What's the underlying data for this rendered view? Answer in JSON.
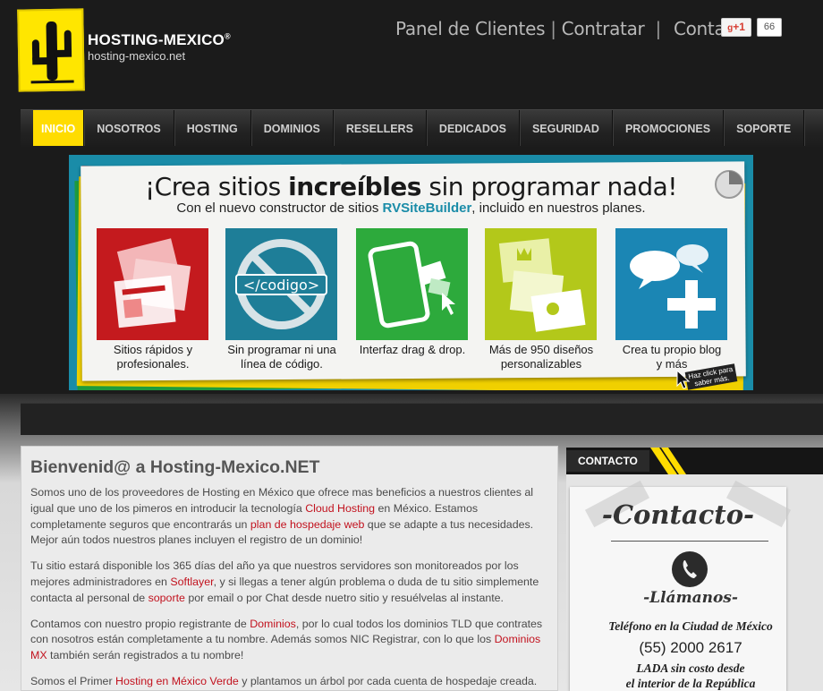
{
  "brand": {
    "name": "HOSTING-MEXICO",
    "reg": "®",
    "url": "hosting-mexico.net"
  },
  "topnav": {
    "clients": "Panel de Clientes",
    "sep1": "|",
    "hire": "Contratar",
    "sep2": "|",
    "contact": "Contacto"
  },
  "social": {
    "gplus_label": "+1",
    "gplus_count": "66"
  },
  "mainnav": [
    "INICIO",
    "NOSOTROS",
    "HOSTING",
    "DOMINIOS",
    "RESELLERS",
    "DEDICADOS",
    "SEGURIDAD",
    "PROMOCIONES",
    "SOPORTE"
  ],
  "banner": {
    "title_pre": "¡Crea sitios ",
    "title_bold": "increíbles",
    "title_post": " sin programar nada!",
    "sub_pre": "Con el nuevo constructor de sitios ",
    "sub_hl": "RVSiteBuilder",
    "sub_post": ", incluido en nuestros planes.",
    "code_text": "</codigo>",
    "tiles": [
      {
        "line1": "Sitios rápidos y",
        "line2": "profesionales."
      },
      {
        "line1": "Sin programar ni una",
        "line2": "línea de código."
      },
      {
        "line1": "Interfaz drag & drop.",
        "line2": ""
      },
      {
        "line1": "Más de 950 diseños",
        "line2": "personalizables"
      },
      {
        "line1": "Crea tu propio blog",
        "line2": "y más"
      }
    ],
    "click_note_1": "Haz click para",
    "click_note_2": "saber más.",
    "colors": {
      "red": "#c41a1e",
      "teal": "#1e7e98",
      "green": "#2daa3c",
      "lime": "#b3c81a",
      "blue": "#1b86b4"
    }
  },
  "content": {
    "heading": "Bienvenid@ a Hosting-Mexico.NET",
    "p1": {
      "a": "Somos uno de los proveedores de Hosting en México que ofrece mas beneficios a nuestros clientes al igual que uno de los pimeros en introducir la tecnología ",
      "link1": "Cloud Hosting",
      "b": " en México. Estamos completamente seguros que encontrarás un ",
      "link2": "plan de hospedaje web",
      "c": " que se adapte a tus necesidades. Mejor aún todos nuestros planes incluyen el registro de un dominio!"
    },
    "p2": {
      "a": "Tu sitio estará disponible los 365 días del año ya que nuestros servidores son monitoreados por los mejores administradores en ",
      "link1": "Softlayer",
      "b": ", y si llegas a tener algún problema o duda de tu sitio simplemente contacta al personal de ",
      "link2": "soporte",
      "c": " por email o por Chat desde nuetro sitio y resuélvelas al instante."
    },
    "p3": {
      "a": "Contamos con nuestro propio registrante de ",
      "link1": "Dominios",
      "b": ", por lo cual todos los dominios TLD que contrates con nosotros están completamente a tu nombre. Además somos NIC Registrar, con lo que los ",
      "link2": "Dominios MX",
      "c": " también serán registrados a tu nombre!"
    },
    "p4": {
      "a": "Somos el Primer ",
      "link1": "Hosting en México Verde",
      "b": " y plantamos un árbol por cada cuenta de hospedaje creada."
    }
  },
  "sidebar": {
    "tab": "CONTACTO",
    "title": "-Contacto-",
    "call": "-Llámanos-",
    "city": "Teléfono en la Ciudad de México",
    "phone": "(55) 2000 2617",
    "lada1": "LADA sin costo desde",
    "lada2": "el interior de la República"
  }
}
